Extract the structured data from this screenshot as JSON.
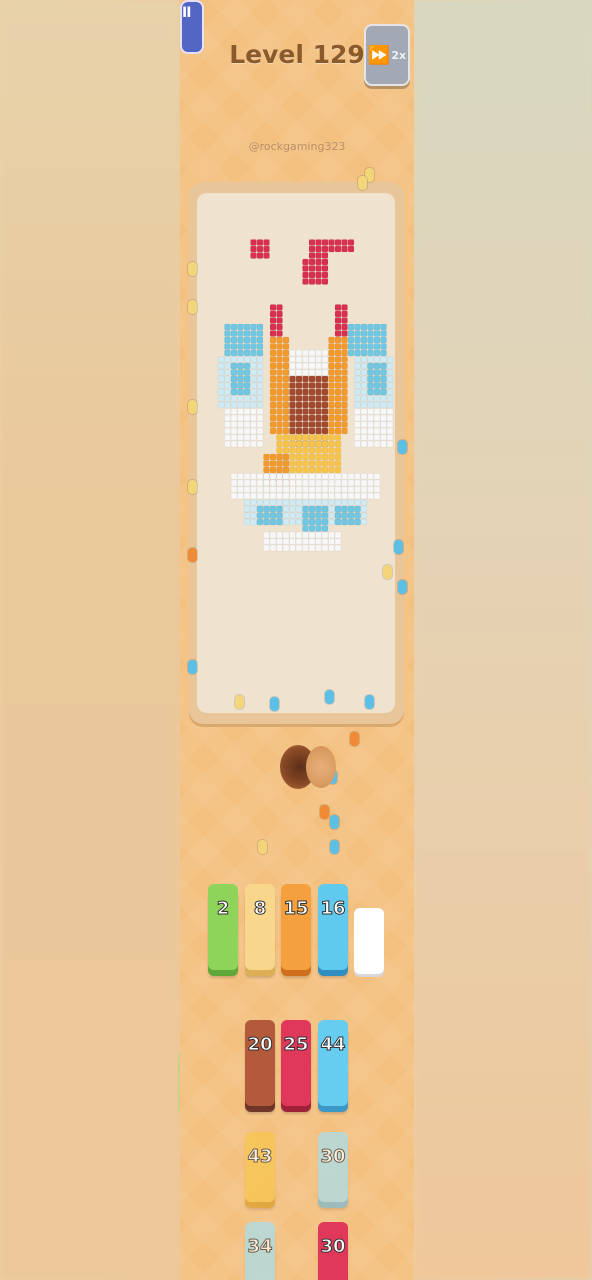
{
  "header": {
    "pause_icon": "pause-icon",
    "pause_glyph": "II",
    "level_label": "Level 129",
    "speed_icon": "fast-forward-icon",
    "speed_glyph": "⏩",
    "speed_label": "2x"
  },
  "watermark": "@rockgaming323",
  "colors": {
    "background": "#f3c080",
    "board": "#efe3cf",
    "board_frame": "#e9c59a",
    "pause_button": "#5466c4",
    "speed_button": "#a2a9b5",
    "level_text": "#8a5a2c"
  },
  "slots": [
    {
      "value": "2",
      "color": "#8fd45a",
      "shadow": "#5ea83a"
    },
    {
      "value": "8",
      "color": "#f8d78d",
      "shadow": "#dcae55"
    },
    {
      "value": "15",
      "color": "#f5a03e",
      "shadow": "#d06f1b"
    },
    {
      "value": "16",
      "color": "#5fc9ee",
      "shadow": "#2f8fc2"
    },
    {
      "value": "",
      "color": "#ffffff",
      "shadow": "#d8d8d8"
    }
  ],
  "stacks_row1": [
    {
      "value": "20",
      "color": "#b35a3c",
      "shadow": "#6e3626"
    },
    {
      "value": "25",
      "color": "#e0385a",
      "shadow": "#9f2138"
    },
    {
      "value": "44",
      "color": "#66cdf0",
      "shadow": "#3b98c6"
    }
  ],
  "stacks_row2": [
    {
      "value": "43",
      "color": "#f8c74a",
      "shadow": "#d99d27"
    },
    {
      "value": "30",
      "color": "#a6dff0",
      "shadow": "#79b9d3"
    }
  ],
  "stacks_row3": [
    {
      "value": "34",
      "color": "#a6dff0",
      "shadow": "#79b9d3"
    },
    {
      "value": "30",
      "color": "#e0385a",
      "shadow": "#9f2138"
    }
  ]
}
